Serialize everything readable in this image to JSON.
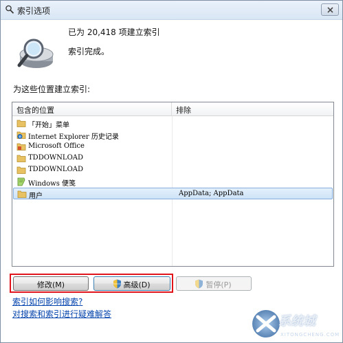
{
  "window": {
    "title": "索引选项"
  },
  "status": {
    "indexed_count_text": "已为 20,418 项建立索引",
    "state_text": "索引完成。"
  },
  "locations": {
    "heading": "为这些位置建立索引:",
    "columns": {
      "included": "包含的位置",
      "excluded": "排除"
    },
    "rows": [
      {
        "name": "「开始」菜单",
        "excluded": "",
        "icon": "folder-icon"
      },
      {
        "name": "Internet Explorer 历史记录",
        "excluded": "",
        "icon": "ie-history-icon"
      },
      {
        "name": "Microsoft Office",
        "excluded": "",
        "icon": "office-icon"
      },
      {
        "name": "TDDOWNLOAD",
        "excluded": "",
        "icon": "folder-icon"
      },
      {
        "name": "TDDOWNLOAD",
        "excluded": "",
        "icon": "folder-icon"
      },
      {
        "name": "Windows 便笺",
        "excluded": "",
        "icon": "sticky-notes-icon"
      },
      {
        "name": "用户",
        "excluded": "AppData; AppData",
        "icon": "folder-icon",
        "selected": true
      }
    ]
  },
  "buttons": {
    "modify": "修改(M)",
    "advanced": "高级(D)",
    "pause": "暂停(P)"
  },
  "links": {
    "how_indexing_affects": "索引如何影响搜索?",
    "troubleshoot": "对搜索和索引进行疑难解答"
  },
  "watermark": {
    "text": "系统城",
    "sub": "XITONGCHENG.COM"
  },
  "colors": {
    "highlight_frame": "#e0131b",
    "link": "#0645ad",
    "selection": "#cee3f7"
  }
}
